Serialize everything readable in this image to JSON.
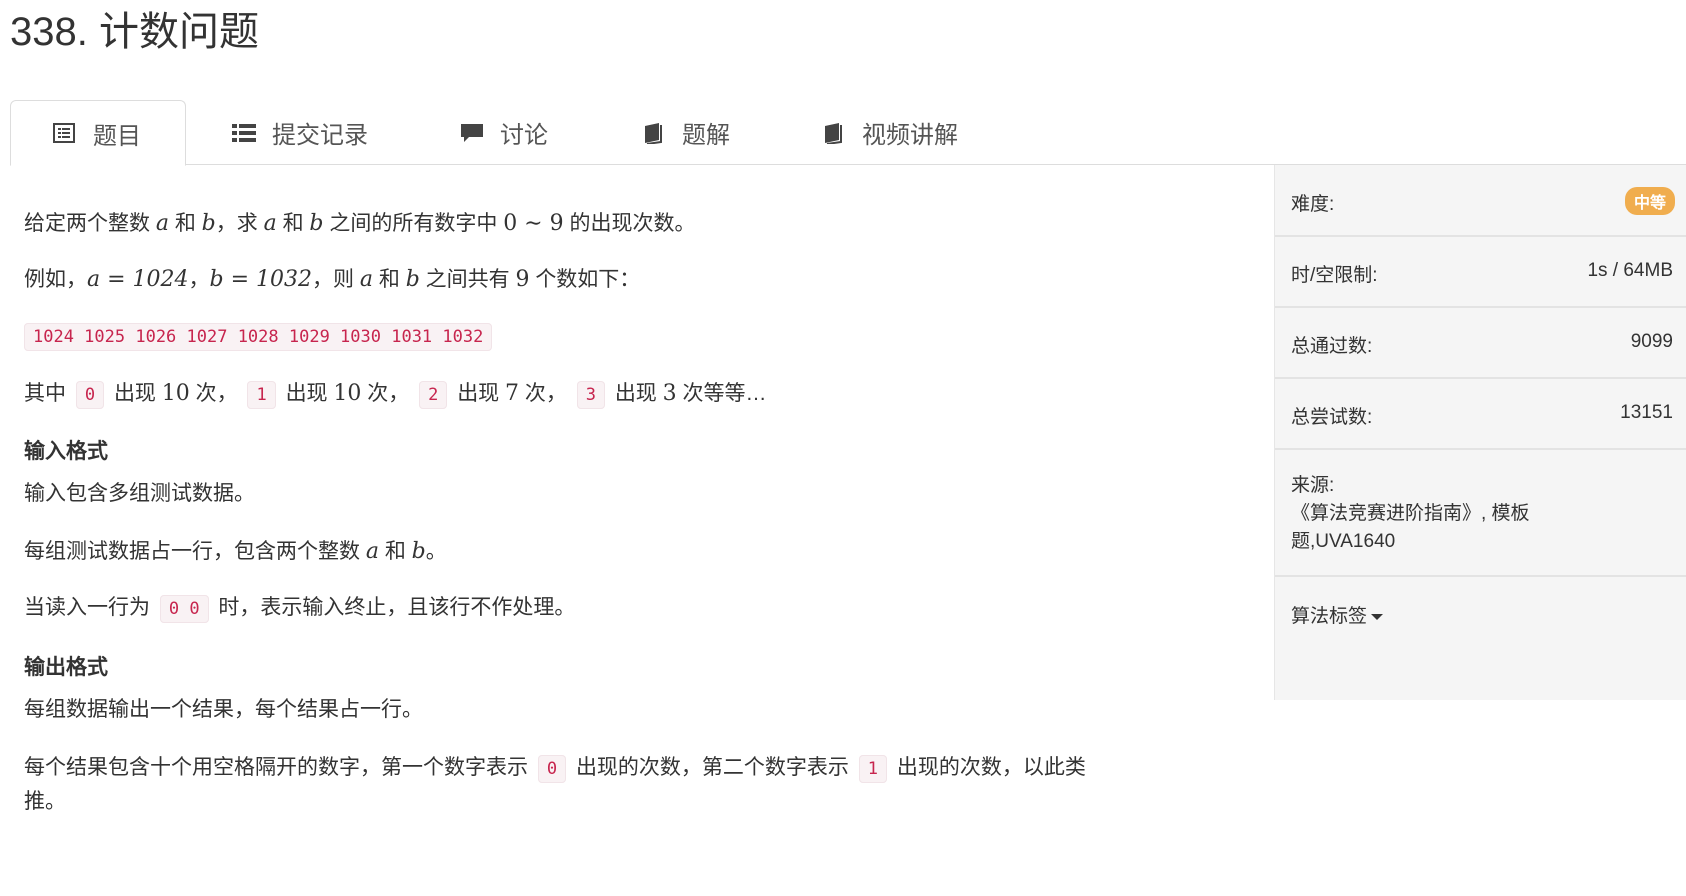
{
  "title": "338. 计数问题",
  "tabs": [
    {
      "label": "题目",
      "icon": "list-alt-icon"
    },
    {
      "label": "提交记录",
      "icon": "list-icon"
    },
    {
      "label": "讨论",
      "icon": "comment-icon"
    },
    {
      "label": "题解",
      "icon": "book-icon"
    },
    {
      "label": "视频讲解",
      "icon": "book-icon"
    }
  ],
  "problem": {
    "intro": {
      "p1": "给定两个整数",
      "a": "a",
      "and": "和",
      "b": "b",
      "p2": "，求",
      "p3": "之间的所有数字中",
      "range": "0 ∼ 9",
      "p4": "的出现次数。"
    },
    "example": {
      "p1": "例如，",
      "eq1": "a = 1024",
      "sep": "，",
      "eq2": "b = 1032",
      "p2": "，则",
      "p3": "之间共有",
      "count": "9",
      "p4": "个数如下："
    },
    "code_numbers": "1024 1025 1026 1027 1028 1029 1030 1031 1032",
    "occurrence": {
      "p0": "其中",
      "d0": "0",
      "t1": "出现",
      "n0": "10",
      "t2": "次，",
      "d1": "1",
      "n1": "10",
      "d2": "2",
      "n2": "7",
      "d3": "3",
      "n3": "3",
      "t3": "次等等…"
    },
    "input_heading": "输入格式",
    "input_p1": "输入包含多组测试数据。",
    "input_p2a": "每组测试数据占一行，包含两个整数",
    "input_p2b": "。",
    "input_p3a": "当读入一行为",
    "input_p3code": "0 0",
    "input_p3b": "时，表示输入终止，且该行不作处理。",
    "output_heading": "输出格式",
    "output_p1": "每组数据输出一个结果，每个结果占一行。",
    "output_p2a": "每个结果包含十个用空格隔开的数字，第一个数字表示",
    "output_p2code0": "0",
    "output_p2b": "出现的次数，第二个数字表示",
    "output_p2code1": "1",
    "output_p2c": "出现的次数，以此类",
    "output_p2d": "推。"
  },
  "sidebar": {
    "difficulty_label": "难度:",
    "difficulty_value": "中等",
    "difficulty_color": "#f0ad4e",
    "limit_label": "时/空限制:",
    "limit_value": "1s / 64MB",
    "passed_label": "总通过数:",
    "passed_value": "9099",
    "tries_label": "总尝试数:",
    "tries_value": "13151",
    "source_label": "来源:",
    "source_line1": "《算法竞赛进阶指南》, 模板",
    "source_line2": "题,UVA1640",
    "tags_label": "算法标签"
  }
}
